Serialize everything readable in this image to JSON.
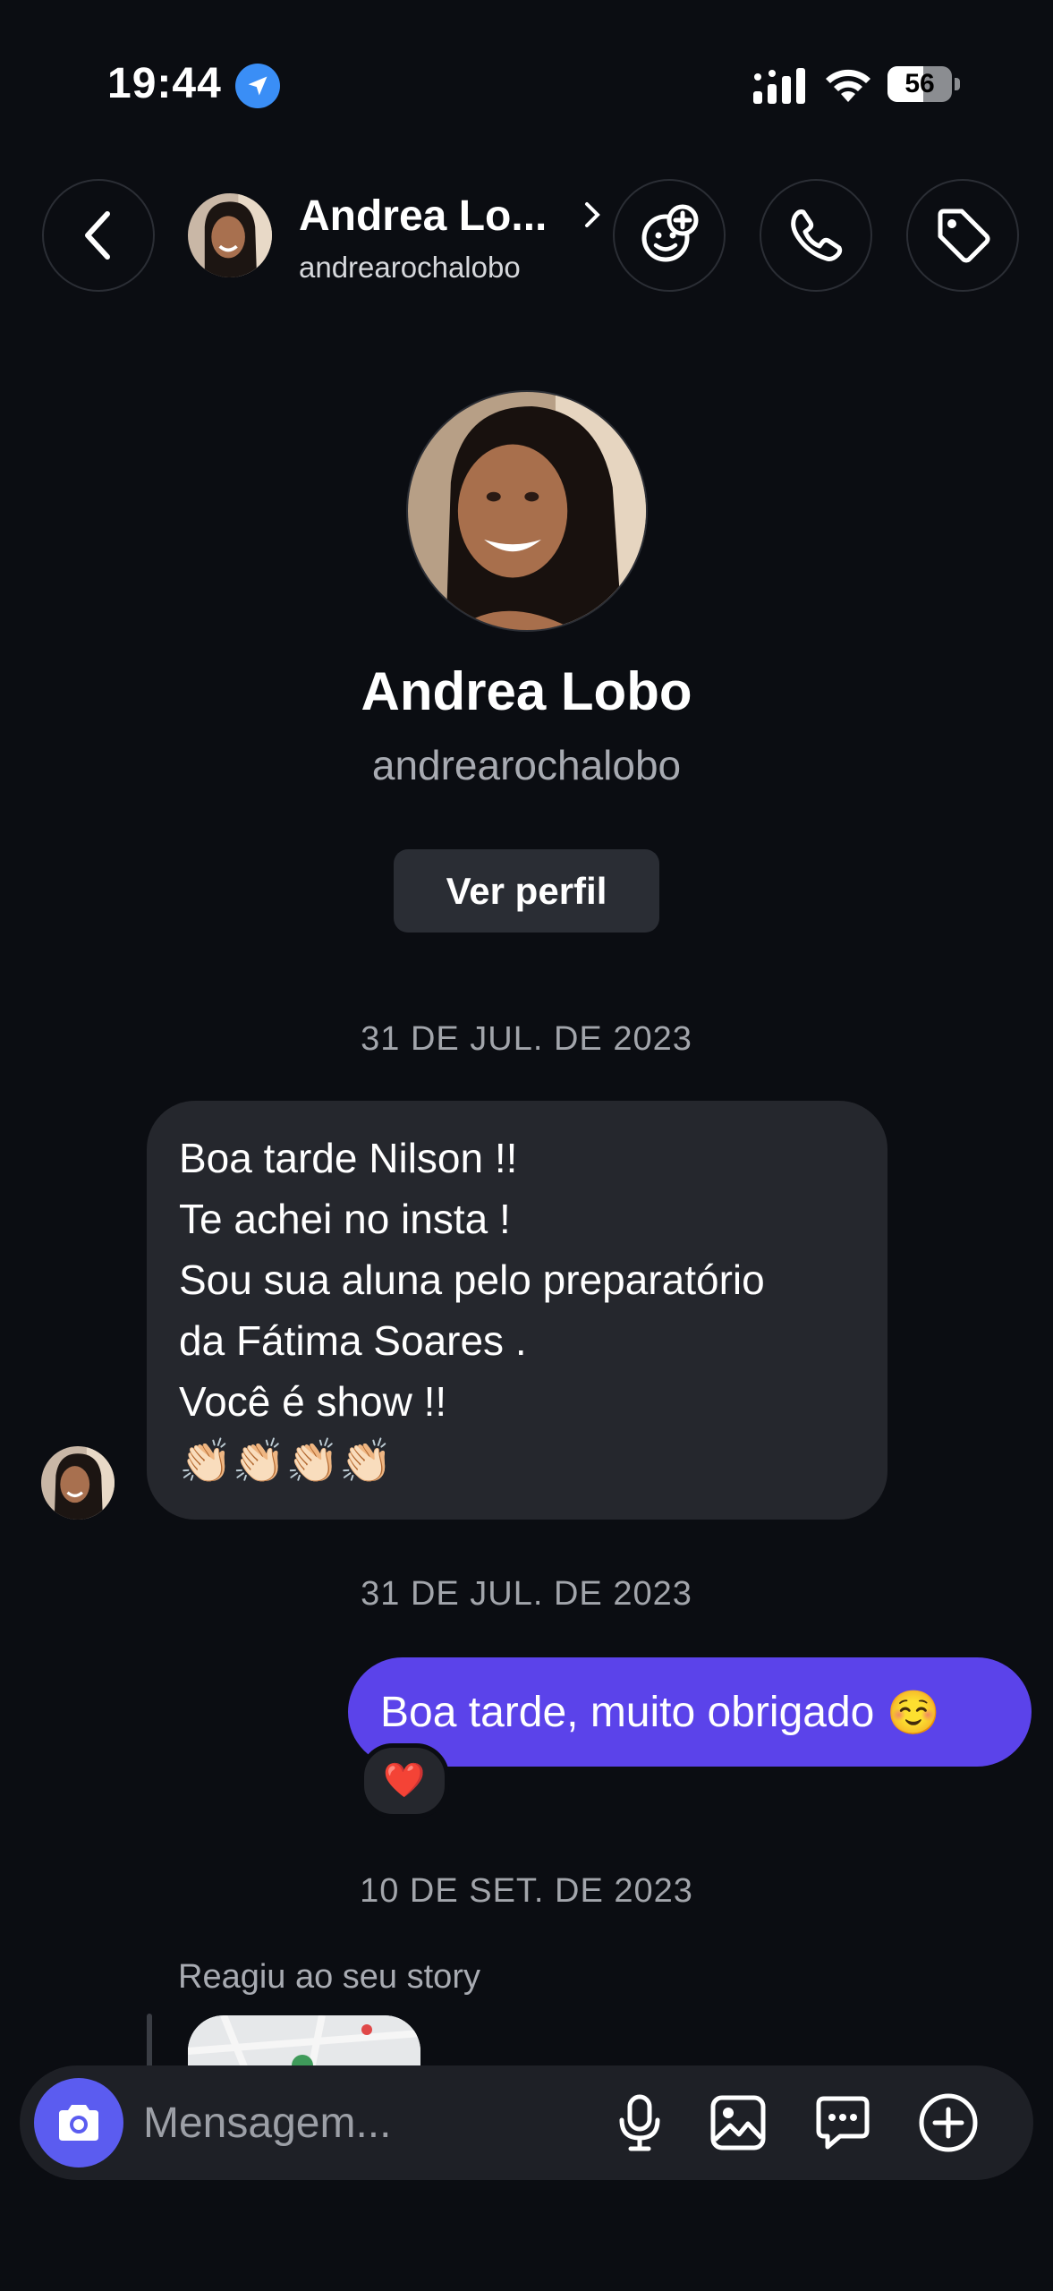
{
  "status_bar": {
    "time": "19:44",
    "battery": "56",
    "battery_level": 0.56
  },
  "header": {
    "name": "Andrea Lo...",
    "username": "andrearochalobo"
  },
  "profile": {
    "name": "Andrea Lobo",
    "username": "andrearochalobo",
    "view_profile_label": "Ver perfil"
  },
  "dates": [
    "31 DE JUL. DE 2023",
    "31 DE JUL. DE 2023",
    "10 DE SET. DE 2023"
  ],
  "messages": {
    "incoming_lines": [
      "Boa tarde  Nilson !!",
      "Te achei no insta !",
      "Sou sua aluna pelo preparatório",
      "da Fátima Soares .",
      "Você é show !!"
    ],
    "incoming_emoji": "👏🏻👏🏻👏🏻👏🏻",
    "outgoing_text": "Boa tarde, muito obrigado",
    "outgoing_emoji": "☺️",
    "reaction": "❤️",
    "story_label": "Reagiu ao seu story"
  },
  "composer": {
    "placeholder": "Mensagem..."
  },
  "icons": [
    "back-icon",
    "sticker-add-icon",
    "phone-icon",
    "tag-icon",
    "camera-icon",
    "microphone-icon",
    "gallery-icon",
    "chat-bubble-icon",
    "plus-circle-icon",
    "location-arrow-icon"
  ],
  "colors": {
    "background": "#0b0d12",
    "incoming_bubble": "#25272d",
    "outgoing_bubble": "#5b43ea",
    "camera_button": "#5b5cf0"
  }
}
